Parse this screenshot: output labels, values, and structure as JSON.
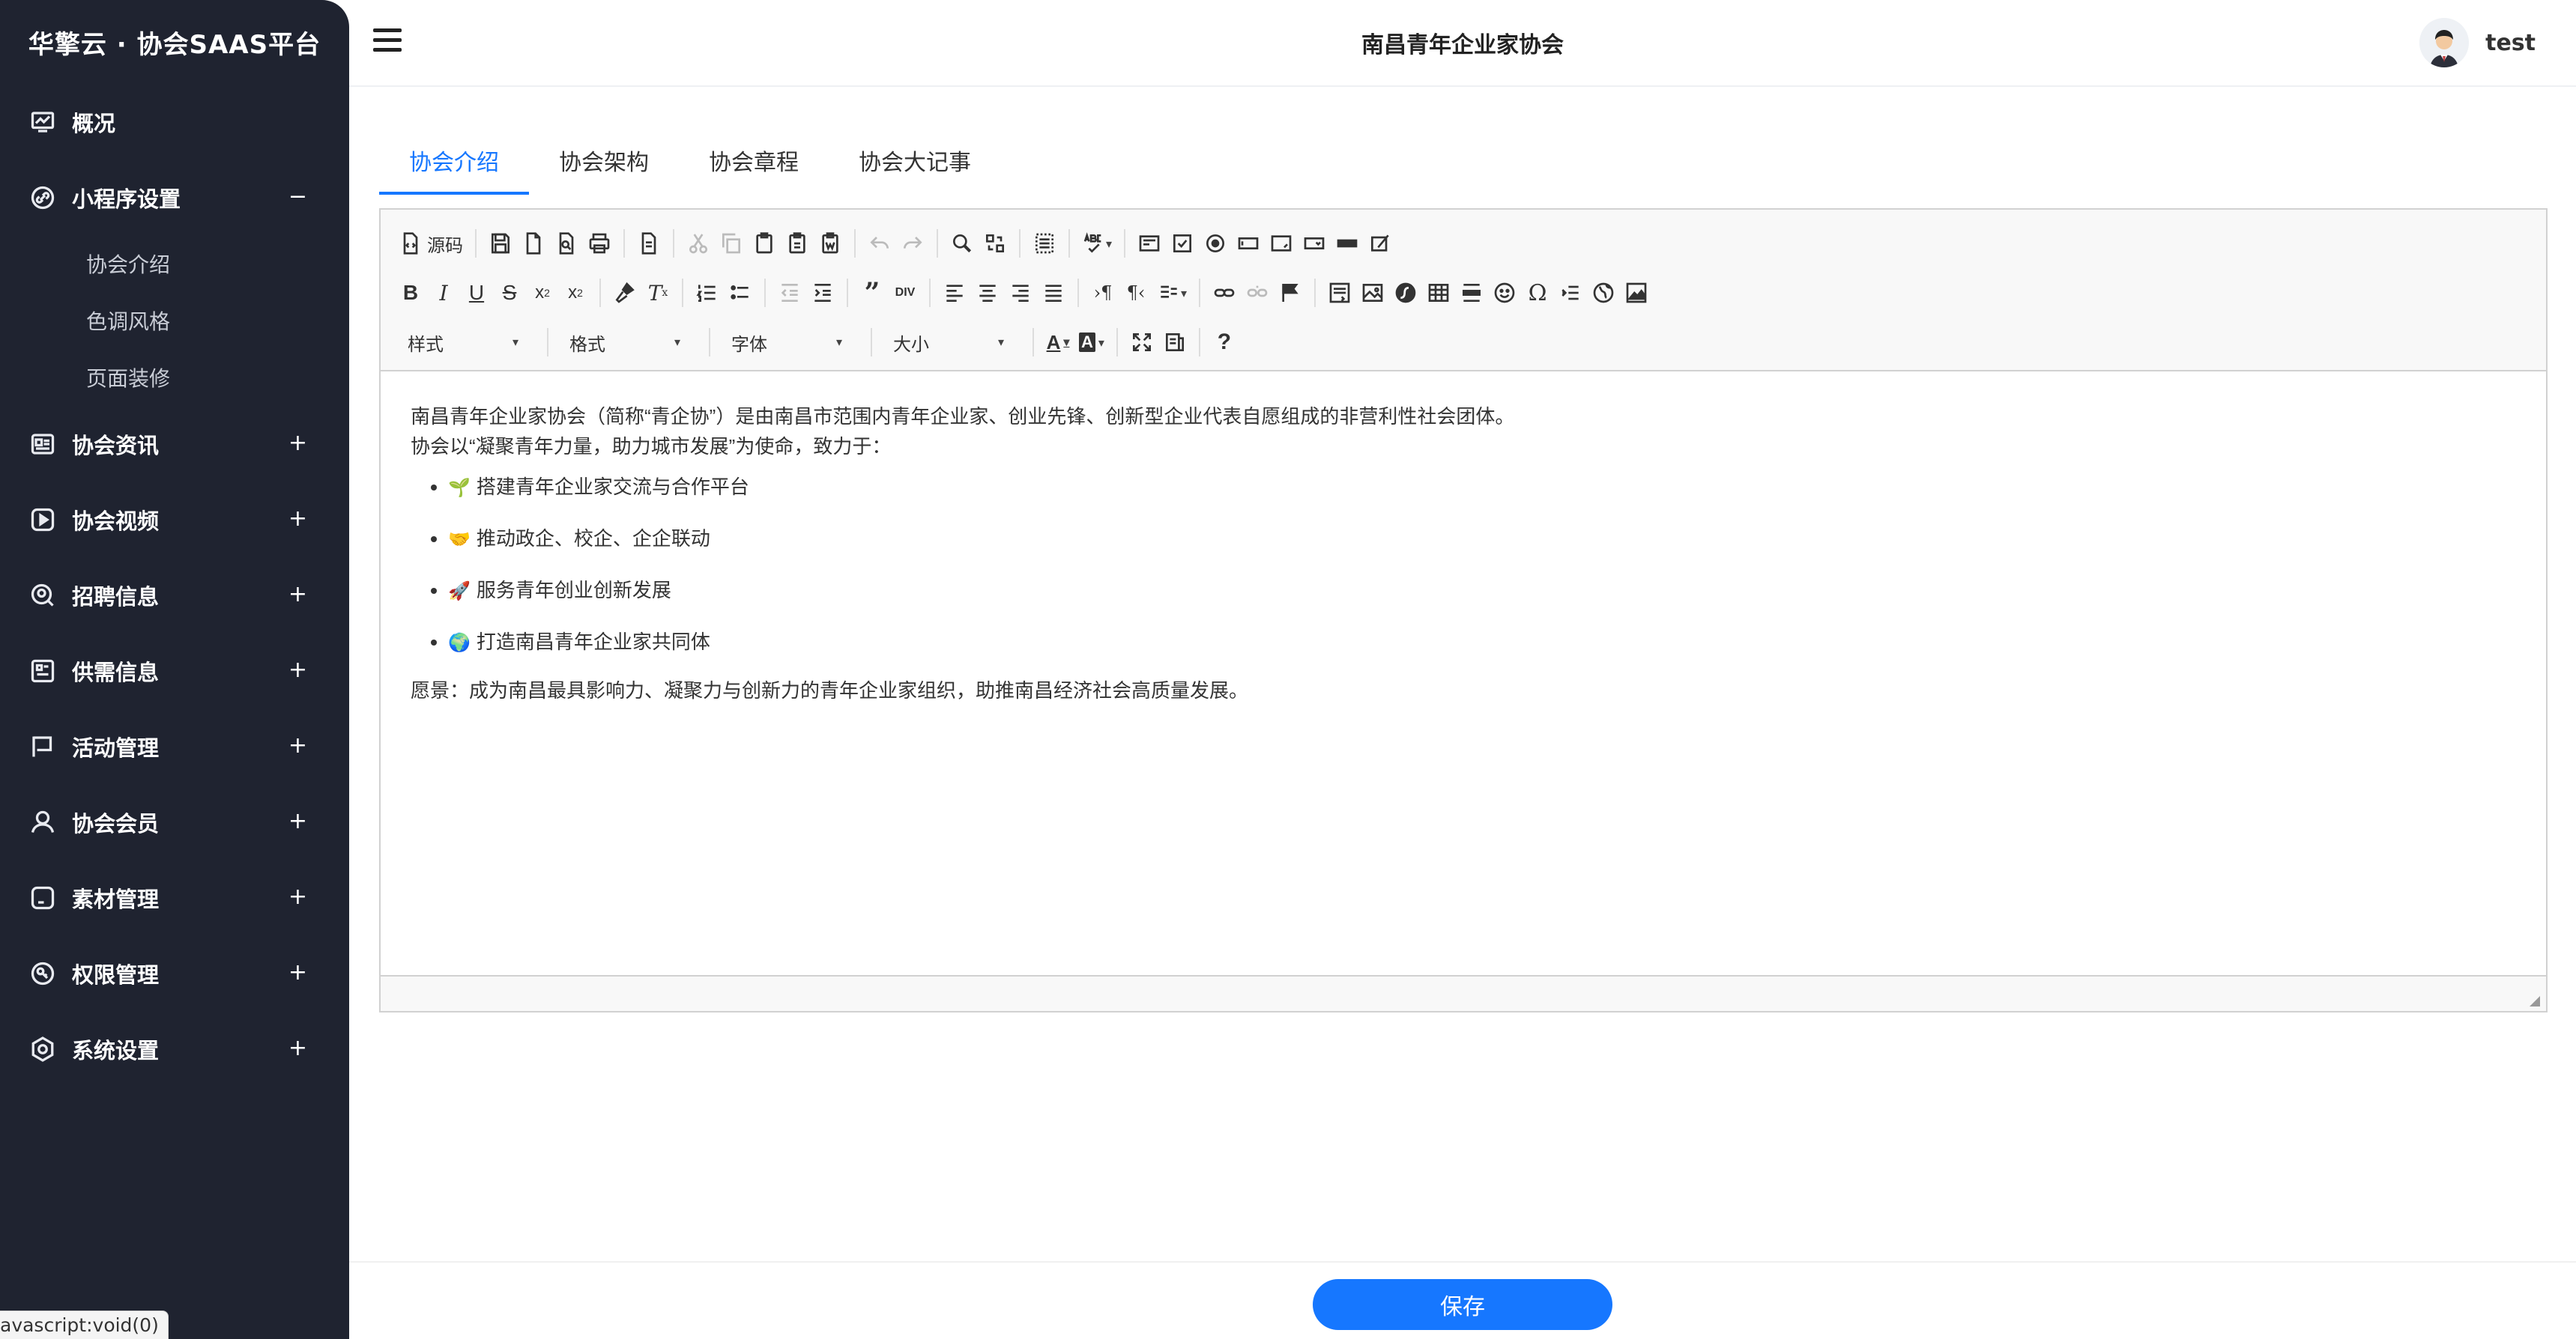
{
  "app": {
    "brand": "华擎云 · 协会SAAS平台",
    "title": "南昌青年企业家协会",
    "user": "test",
    "status_url": "avascript:void(0)"
  },
  "sidebar": {
    "items": [
      {
        "label": "概况",
        "icon": "monitor-chart-icon",
        "toggle": ""
      },
      {
        "label": "小程序设置",
        "icon": "link-icon",
        "toggle": "−"
      },
      {
        "label": "协会资讯",
        "icon": "newspaper-icon",
        "toggle": "+"
      },
      {
        "label": "协会视频",
        "icon": "video-play-icon",
        "toggle": "+"
      },
      {
        "label": "招聘信息",
        "icon": "recruit-search-icon",
        "toggle": "+"
      },
      {
        "label": "供需信息",
        "icon": "supply-demand-icon",
        "toggle": "+"
      },
      {
        "label": "活动管理",
        "icon": "flag-icon",
        "toggle": "+"
      },
      {
        "label": "协会会员",
        "icon": "user-icon",
        "toggle": "+"
      },
      {
        "label": "素材管理",
        "icon": "folder-icon",
        "toggle": "+"
      },
      {
        "label": "权限管理",
        "icon": "key-icon",
        "toggle": "+"
      },
      {
        "label": "系统设置",
        "icon": "gear-icon",
        "toggle": "+"
      }
    ],
    "sub_items": [
      "协会介绍",
      "色调风格",
      "页面装修"
    ]
  },
  "tabs": [
    "协会介绍",
    "协会架构",
    "协会章程",
    "协会大记事"
  ],
  "editor": {
    "source_label": "源码",
    "combos": [
      "样式",
      "格式",
      "字体",
      "大小"
    ],
    "content": {
      "intro_line1": "南昌青年企业家协会（简称“青企协”）是由南昌市范围内青年企业家、创业先锋、创新型企业代表自愿组成的非营利性社会团体。",
      "intro_line2": "协会以“凝聚青年力量，助力城市发展”为使命，致力于：",
      "bullets": [
        {
          "emoji": "🌱",
          "text": "搭建青年企业家交流与合作平台"
        },
        {
          "emoji": "🤝",
          "text": "推动政企、校企、企企联动"
        },
        {
          "emoji": "🚀",
          "text": "服务青年创业创新发展"
        },
        {
          "emoji": "🌍",
          "text": "打造南昌青年企业家共同体"
        }
      ],
      "vision": "愿景：成为南昌最具影响力、凝聚力与创新力的青年企业家组织，助推南昌经济社会高质量发展。"
    }
  },
  "actions": {
    "save_label": "保存"
  },
  "colors": {
    "sidebar_bg": "#1f2330",
    "accent": "#1677ff"
  }
}
